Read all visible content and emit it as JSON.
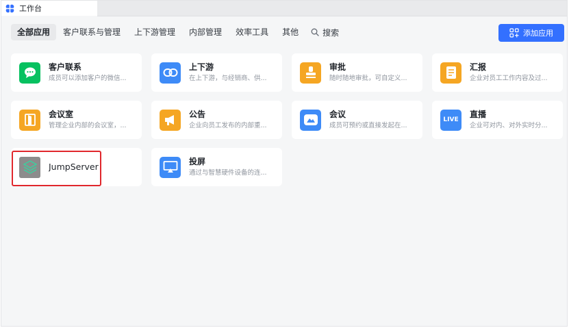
{
  "window": {
    "title": "工作台"
  },
  "tabs": [
    {
      "label": "全部应用",
      "active": true
    },
    {
      "label": "客户联系与管理"
    },
    {
      "label": "上下游管理"
    },
    {
      "label": "内部管理"
    },
    {
      "label": "效率工具"
    },
    {
      "label": "其他"
    }
  ],
  "search": {
    "label": "搜索",
    "icon": "search-icon"
  },
  "add_button": {
    "label": "添加应用",
    "icon": "add-app-icon"
  },
  "apps": [
    {
      "name": "客户联系",
      "desc": "成员可以添加客户的微信...",
      "icon": "wechat-icon",
      "color": "#07c160"
    },
    {
      "name": "上下游",
      "desc": "在上下游，与经销商、供...",
      "icon": "link-icon",
      "color": "#3e8bf7"
    },
    {
      "name": "审批",
      "desc": "随时随地审批，可自定义...",
      "icon": "stamp-icon",
      "color": "#f5a623"
    },
    {
      "name": "汇报",
      "desc": "企业对员工工作内容及过...",
      "icon": "report-icon",
      "color": "#f5a623"
    },
    {
      "name": "会议室",
      "desc": "管理企业内部的会议室，...",
      "icon": "door-icon",
      "color": "#f5a623"
    },
    {
      "name": "公告",
      "desc": "企业向员工发布的内部重...",
      "icon": "megaphone-icon",
      "color": "#f5a623"
    },
    {
      "name": "会议",
      "desc": "成员可预约或直接发起在...",
      "icon": "meeting-icon",
      "color": "#3e8bf7"
    },
    {
      "name": "直播",
      "desc": "企业可对内、对外实时分...",
      "icon": "live-icon",
      "color": "#3e8bf7",
      "badge": "LIVE"
    },
    {
      "name": "JumpServer",
      "desc": "",
      "icon": "jumpserver-icon",
      "color": "#8c8c8c"
    },
    {
      "name": "投屏",
      "desc": "通过与智慧硬件设备的连...",
      "icon": "screen-cast-icon",
      "color": "#3e8bf7"
    }
  ],
  "highlighted_app": "JumpServer"
}
